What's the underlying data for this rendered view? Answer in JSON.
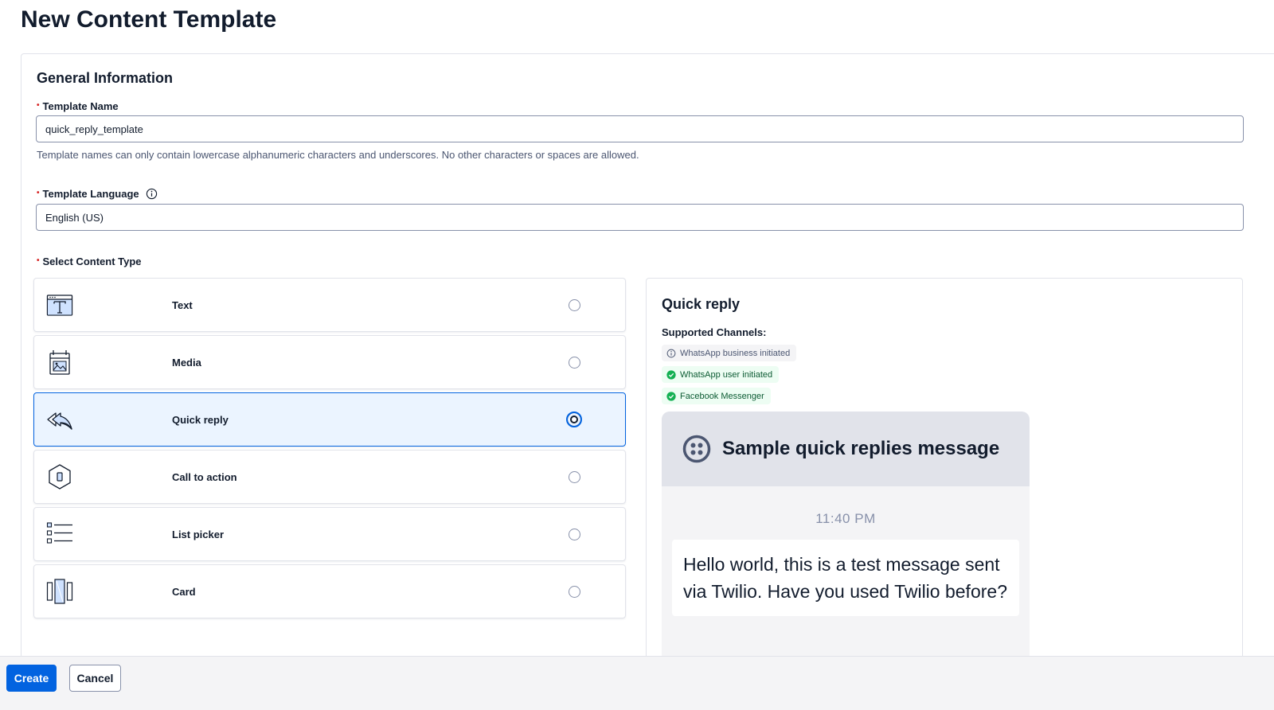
{
  "page": {
    "title": "New Content Template"
  },
  "general": {
    "title": "General Information",
    "required_marker": "•",
    "template_name": {
      "label": "Template Name",
      "value": "quick_reply_template",
      "help": "Template names can only contain lowercase alphanumeric characters and underscores. No other characters or spaces are allowed."
    },
    "template_language": {
      "label": "Template Language",
      "value": "English (US)",
      "info_icon": "info-icon"
    }
  },
  "content_type": {
    "label": "Select Content Type",
    "items": [
      {
        "label": "Text",
        "icon": "text-template-icon",
        "selected": false
      },
      {
        "label": "Media",
        "icon": "media-icon",
        "selected": false
      },
      {
        "label": "Quick reply",
        "icon": "reply-all-icon",
        "selected": true
      },
      {
        "label": "Call to action",
        "icon": "call-to-action-icon",
        "selected": false
      },
      {
        "label": "List picker",
        "icon": "list-icon",
        "selected": false
      },
      {
        "label": "Card",
        "icon": "card-icon",
        "selected": false
      }
    ]
  },
  "preview": {
    "title": "Quick reply",
    "channels_label": "Supported Channels:",
    "channels": [
      {
        "label": "WhatsApp business initiated",
        "status": "info",
        "icon": "info-icon"
      },
      {
        "label": "WhatsApp user initiated",
        "status": "success",
        "icon": "check-circle-icon"
      },
      {
        "label": "Facebook Messenger",
        "status": "success",
        "icon": "check-circle-icon"
      }
    ],
    "phone": {
      "header_title": "Sample quick replies message",
      "logo_icon": "twilio-logo-icon",
      "time": "11:40 PM",
      "message": "Hello world, this is a test message sent via Twilio. Have you used Twilio before?"
    }
  },
  "footer": {
    "create_label": "Create",
    "cancel_label": "Cancel"
  },
  "colors": {
    "primary": "#0263e0",
    "selected_bg": "#ebf4ff",
    "success_text": "#0c5b33",
    "success_bg": "#edfdf3",
    "error": "#d61f1f",
    "text": "#121c2d"
  }
}
